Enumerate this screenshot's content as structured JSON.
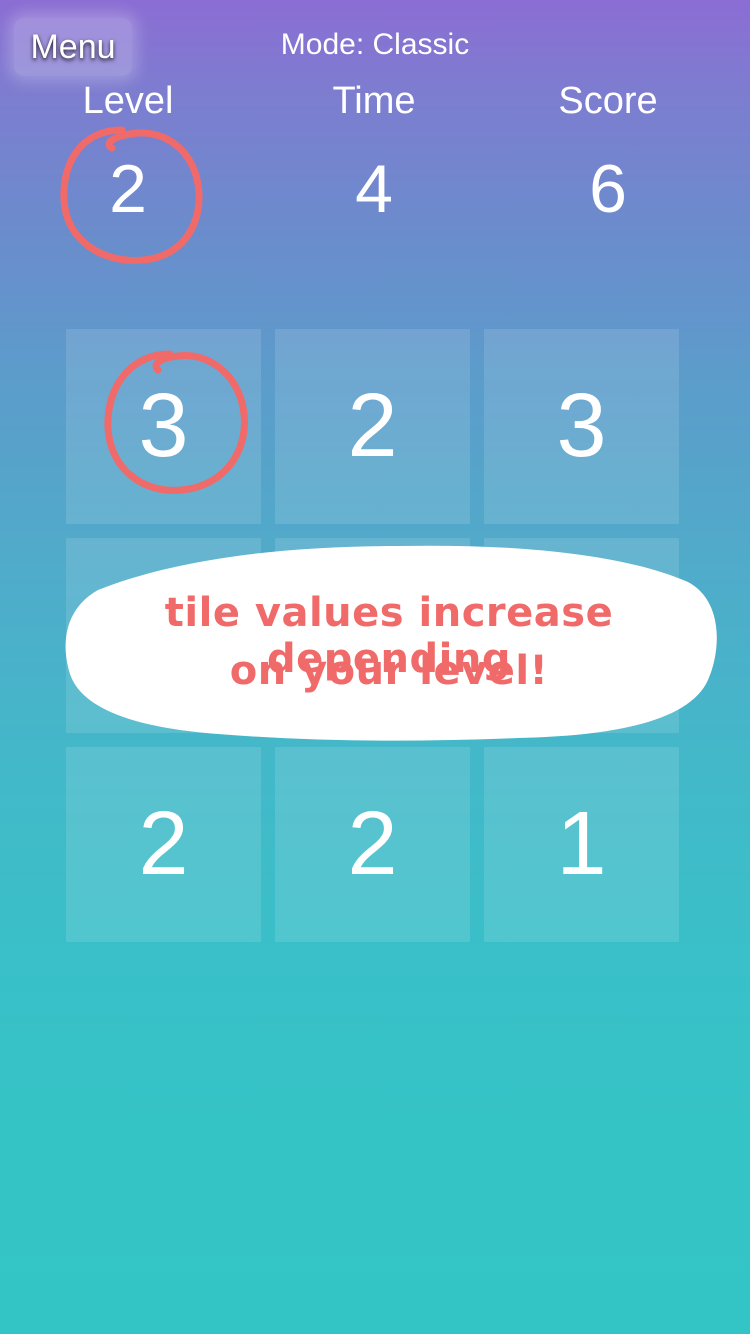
{
  "header": {
    "menu_label": "Menu",
    "mode_label": "Mode: Classic"
  },
  "stats": {
    "level_label": "Level",
    "level_value": "2",
    "time_label": "Time",
    "time_value": "4",
    "score_label": "Score",
    "score_value": "6"
  },
  "board": {
    "tiles": [
      [
        "3",
        "2",
        "3"
      ],
      [
        "",
        "",
        ""
      ],
      [
        "2",
        "2",
        "1"
      ]
    ]
  },
  "annotation": {
    "line1": "tile values increase depending",
    "line2": "on your level!",
    "highlight_color": "#f06a6a"
  }
}
